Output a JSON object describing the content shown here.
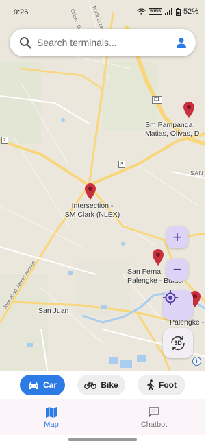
{
  "status_bar": {
    "time": "9:26",
    "wifi_label": "WiFi6",
    "battery": "52%"
  },
  "search": {
    "placeholder": "Search terminals..."
  },
  "map": {
    "place_labels": {
      "intersection": [
        "Intersection -",
        "SM Clark (NLEX)"
      ],
      "sm_pampanga": [
        "Sm Pampanga",
        "Matias, Olivas, D"
      ],
      "san_fernando": [
        "San Ferna",
        "Palengke - Bulaon"
      ],
      "san_fernando2": [
        "(...) Fer",
        "Palengke -",
        "pan"
      ],
      "san_juan": "San Juan",
      "san_partial": "SAN"
    },
    "road_labels": {
      "abad_santos": "Jose Abad Santos Avenue",
      "road_top": "Calsia - Do",
      "road_north": "North Luzon"
    },
    "shields": {
      "e1": "E1",
      "r2": "2",
      "r3": "3"
    },
    "controls": {
      "zoom_in": "+",
      "zoom_out": "−",
      "three_d": "3D",
      "info": "i"
    },
    "colors": {
      "pin": "#c9303f",
      "accent": "#2d7be5",
      "control_bg": "#ddd3f7"
    }
  },
  "transport_modes": [
    {
      "label": "Car",
      "selected": true
    },
    {
      "label": "Bike",
      "selected": false
    },
    {
      "label": "Foot",
      "selected": false
    }
  ],
  "bottom_nav": [
    {
      "label": "Map",
      "active": true
    },
    {
      "label": "Chatbot",
      "active": false
    }
  ]
}
